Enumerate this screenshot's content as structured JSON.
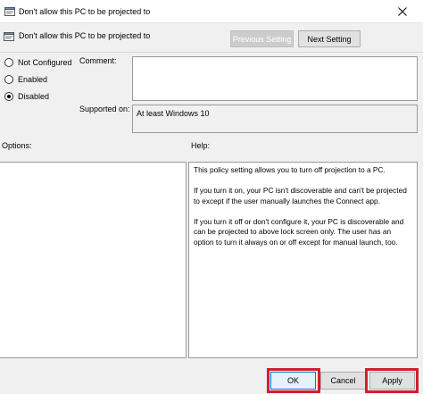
{
  "window": {
    "title": "Don't allow this PC to be projected to",
    "close_icon": "close-icon"
  },
  "header": {
    "policy_name": "Don't allow this PC to be projected to",
    "icon": "policy-settings-icon"
  },
  "nav": {
    "previous_label": "Previous Setting",
    "next_label": "Next Setting"
  },
  "state": {
    "options": [
      {
        "label": "Not Configured",
        "checked": false
      },
      {
        "label": "Enabled",
        "checked": false
      },
      {
        "label": "Disabled",
        "checked": true
      }
    ]
  },
  "comment": {
    "label": "Comment:",
    "value": ""
  },
  "supported": {
    "label": "Supported on:",
    "value": "At least Windows 10"
  },
  "options_pane": {
    "label": "Options:"
  },
  "help": {
    "label": "Help:",
    "paragraphs": [
      "This policy setting allows you to turn off projection to a PC.",
      "If you turn it on, your PC isn't discoverable and can't be projected to except if the user manually launches the Connect app.",
      "If you turn it off or don't configure it, your PC is discoverable and can be projected to above lock screen only. The user has an option to turn it always on or off except for manual launch, too."
    ]
  },
  "footer": {
    "ok_label": "OK",
    "cancel_label": "Cancel",
    "apply_label": "Apply"
  },
  "colors": {
    "highlight": "#d0202e",
    "ok_border": "#0078d7"
  }
}
